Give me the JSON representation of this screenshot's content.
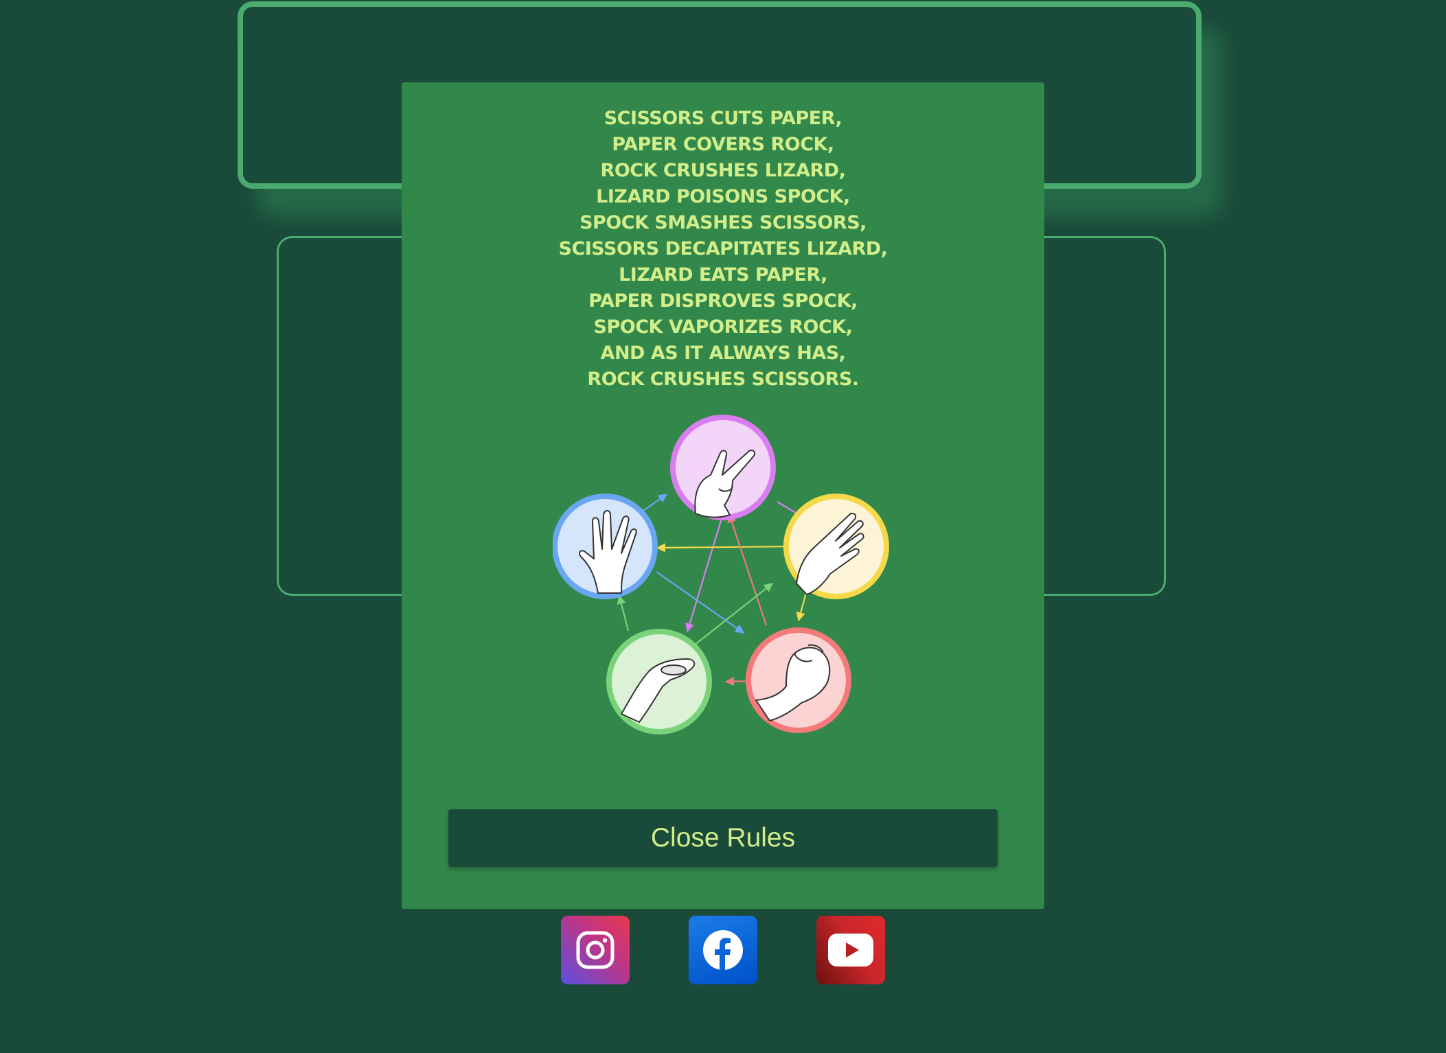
{
  "rules": {
    "lines": [
      "SCISSORS CUTS PAPER,",
      "PAPER COVERS ROCK,",
      "ROCK CRUSHES LIZARD,",
      "LIZARD POISONS SPOCK,",
      "SPOCK SMASHES SCISSORS,",
      "SCISSORS DECAPITATES LIZARD,",
      "LIZARD EATS PAPER,",
      "PAPER DISPROVES SPOCK,",
      "SPOCK VAPORIZES ROCK,",
      "AND AS IT ALWAYS HAS,",
      "ROCK CRUSHES SCISSORS."
    ]
  },
  "diagram": {
    "nodes": [
      {
        "id": "scissors",
        "icon": "scissors-hand-icon",
        "color": "#d97ef0",
        "fill": "#f4d5fa"
      },
      {
        "id": "paper",
        "icon": "paper-hand-icon",
        "color": "#f5d94a",
        "fill": "#fdf3d6"
      },
      {
        "id": "rock",
        "icon": "rock-hand-icon",
        "color": "#f27a7a",
        "fill": "#fbd3d3"
      },
      {
        "id": "lizard",
        "icon": "lizard-hand-icon",
        "color": "#7ad27a",
        "fill": "#dbf2d6"
      },
      {
        "id": "spock",
        "icon": "spock-hand-icon",
        "color": "#6aa6f2",
        "fill": "#d5e5fb"
      }
    ]
  },
  "close_button": {
    "label": "Close Rules"
  },
  "social": [
    {
      "name": "instagram",
      "icon": "instagram-icon"
    },
    {
      "name": "facebook",
      "icon": "facebook-icon"
    },
    {
      "name": "youtube",
      "icon": "youtube-icon"
    }
  ],
  "colors": {
    "background": "#1a4a3a",
    "modal": "#32874a",
    "accent_text": "#d2ee8a",
    "border": "#4aaa70"
  }
}
